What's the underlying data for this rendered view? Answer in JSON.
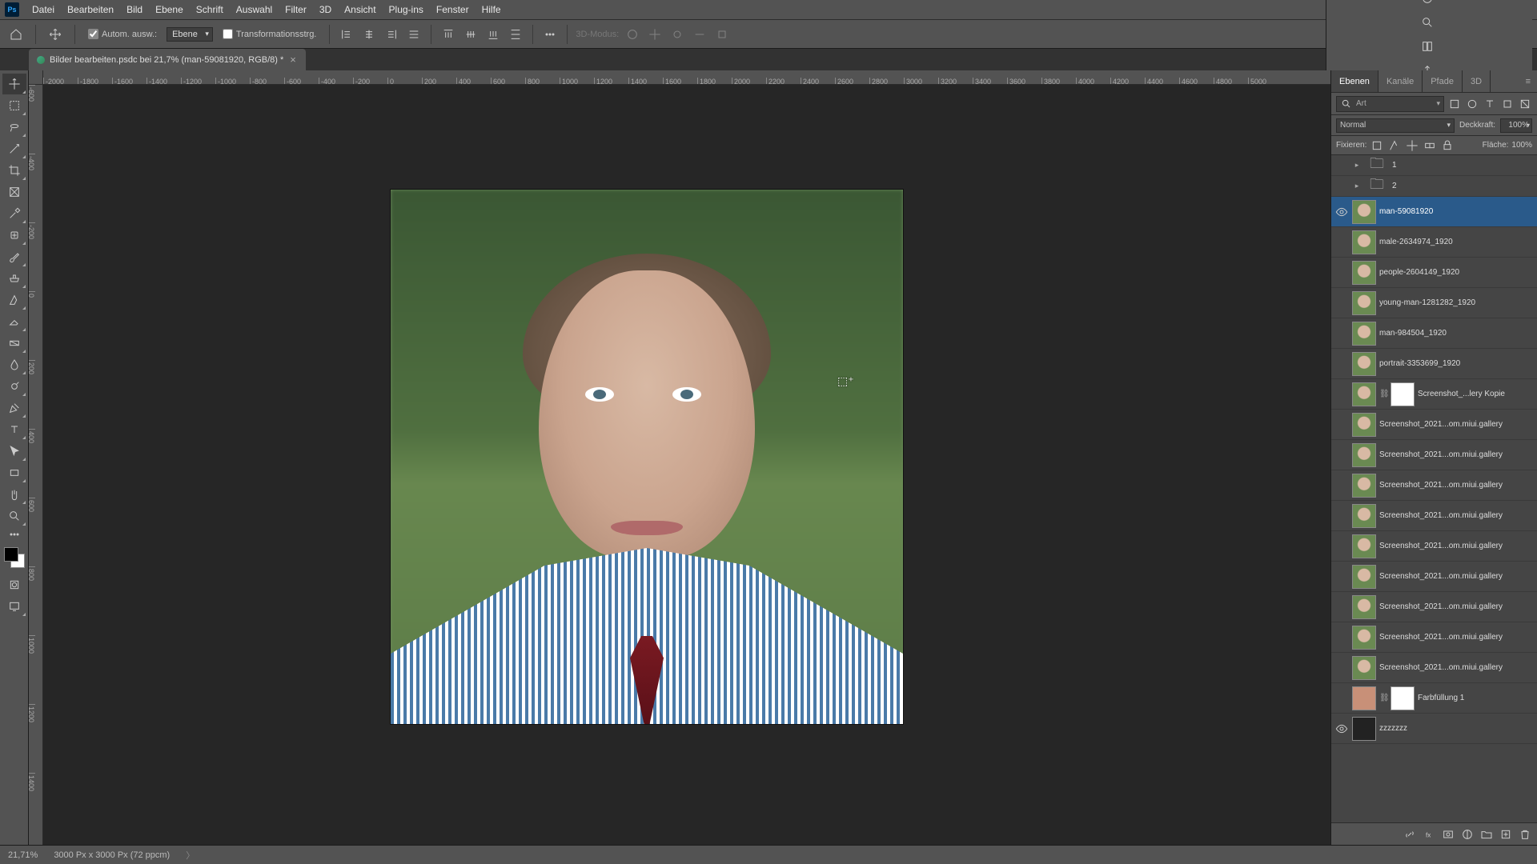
{
  "menubar": {
    "items": [
      "Datei",
      "Bearbeiten",
      "Bild",
      "Ebene",
      "Schrift",
      "Auswahl",
      "Filter",
      "3D",
      "Ansicht",
      "Plug-ins",
      "Fenster",
      "Hilfe"
    ]
  },
  "optbar": {
    "auto_select_label": "Autom. ausw.:",
    "auto_select_mode": "Ebene",
    "transform_label": "Transformationsstrg.",
    "threeD_label": "3D-Modus:"
  },
  "tab": {
    "title": "Bilder bearbeiten.psdc bei 21,7% (man-59081920, RGB/8) *"
  },
  "rulerH": [
    "-2000",
    "-1800",
    "-1600",
    "-1400",
    "-1200",
    "-1000",
    "-800",
    "-600",
    "-400",
    "-200",
    "0",
    "200",
    "400",
    "600",
    "800",
    "1000",
    "1200",
    "1400",
    "1600",
    "1800",
    "2000",
    "2200",
    "2400",
    "2600",
    "2800",
    "3000",
    "3200",
    "3400",
    "3600",
    "3800",
    "4000",
    "4200",
    "4400",
    "4600",
    "4800",
    "5000"
  ],
  "rulerV": [
    "-600",
    "-400",
    "-200",
    "0",
    "200",
    "400",
    "600",
    "800",
    "1000",
    "1200",
    "1400"
  ],
  "panel": {
    "tabs": [
      "Ebenen",
      "Kanäle",
      "Pfade",
      "3D"
    ],
    "search_placeholder": "Art",
    "blend_mode": "Normal",
    "opacity_label": "Deckkraft:",
    "opacity_value": "100%",
    "lock_label": "Fixieren:",
    "fill_label": "Fläche:",
    "fill_value": "100%"
  },
  "layers": [
    {
      "kind": "group",
      "name": "1",
      "visible": false
    },
    {
      "kind": "group",
      "name": "2",
      "visible": false
    },
    {
      "kind": "layer",
      "name": "man-59081920",
      "visible": true,
      "selected": true,
      "thumb": "face"
    },
    {
      "kind": "layer",
      "name": "male-2634974_1920",
      "visible": false,
      "thumb": "face"
    },
    {
      "kind": "layer",
      "name": "people-2604149_1920",
      "visible": false,
      "thumb": "face"
    },
    {
      "kind": "layer",
      "name": "young-man-1281282_1920",
      "visible": false,
      "thumb": "face"
    },
    {
      "kind": "layer",
      "name": "man-984504_1920",
      "visible": false,
      "thumb": "face"
    },
    {
      "kind": "layer",
      "name": "portrait-3353699_1920",
      "visible": false,
      "thumb": "face"
    },
    {
      "kind": "layer",
      "name": "Screenshot_...lery Kopie",
      "visible": false,
      "thumb": "face",
      "mask": true,
      "link": true
    },
    {
      "kind": "layer",
      "name": "Screenshot_2021...om.miui.gallery",
      "visible": false,
      "thumb": "face"
    },
    {
      "kind": "layer",
      "name": "Screenshot_2021...om.miui.gallery",
      "visible": false,
      "thumb": "face"
    },
    {
      "kind": "layer",
      "name": "Screenshot_2021...om.miui.gallery",
      "visible": false,
      "thumb": "face"
    },
    {
      "kind": "layer",
      "name": "Screenshot_2021...om.miui.gallery",
      "visible": false,
      "thumb": "face"
    },
    {
      "kind": "layer",
      "name": "Screenshot_2021...om.miui.gallery",
      "visible": false,
      "thumb": "face"
    },
    {
      "kind": "layer",
      "name": "Screenshot_2021...om.miui.gallery",
      "visible": false,
      "thumb": "face"
    },
    {
      "kind": "layer",
      "name": "Screenshot_2021...om.miui.gallery",
      "visible": false,
      "thumb": "face"
    },
    {
      "kind": "layer",
      "name": "Screenshot_2021...om.miui.gallery",
      "visible": false,
      "thumb": "face"
    },
    {
      "kind": "layer",
      "name": "Screenshot_2021...om.miui.gallery",
      "visible": false,
      "thumb": "face"
    },
    {
      "kind": "layer",
      "name": "Farbfüllung 1",
      "visible": false,
      "thumb": "color",
      "mask": true,
      "link": true
    },
    {
      "kind": "layer",
      "name": "zzzzzzz",
      "visible": true,
      "thumb": "dark"
    }
  ],
  "status": {
    "zoom": "21,71%",
    "docinfo": "3000 Px x 3000 Px (72 ppcm)"
  }
}
